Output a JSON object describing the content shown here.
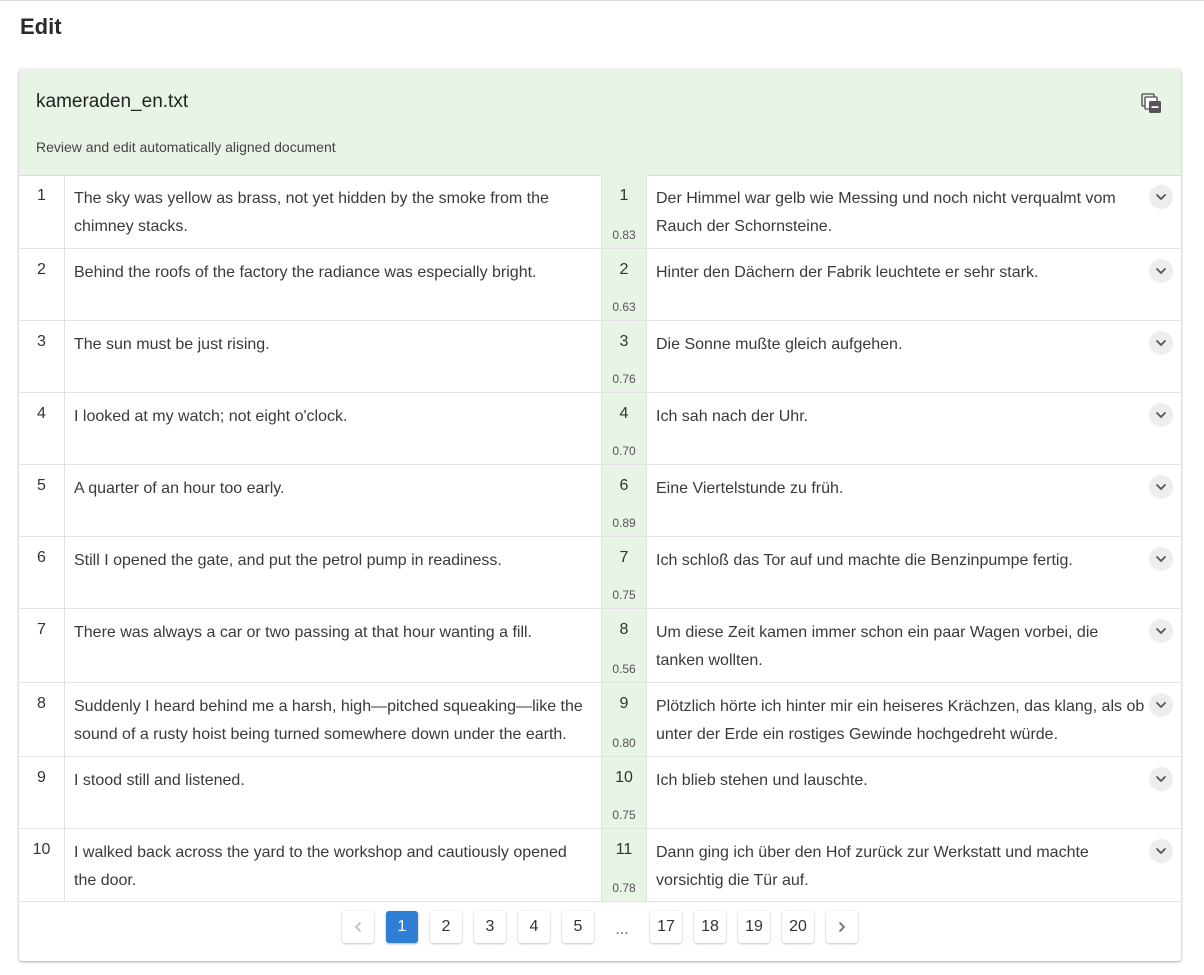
{
  "page": {
    "title": "Edit"
  },
  "document": {
    "file_name": "kameraden_en.txt",
    "subtitle": "Review and edit automatically aligned document"
  },
  "icons": {
    "copy": "copy-icon",
    "expand": "chevron-down-icon",
    "prev": "chevron-left-icon",
    "next": "chevron-right-icon"
  },
  "colors": {
    "header_bg": "#e8f4e6",
    "active_page": "#2f7fd6"
  },
  "rows": [
    {
      "num": "1",
      "source": "The sky was yellow as brass, not yet hidden by the smoke from the chimney stacks.",
      "target_num": "1",
      "score": "0.83",
      "target": "Der Himmel war gelb wie Messing und noch nicht verqualmt vom Rauch der Schornsteine."
    },
    {
      "num": "2",
      "source": "Behind the roofs of the factory the radiance was especially bright.",
      "target_num": "2",
      "score": "0.63",
      "target": "Hinter den Dächern der Fabrik leuchtete er sehr stark."
    },
    {
      "num": "3",
      "source": "The sun must be just rising.",
      "target_num": "3",
      "score": "0.76",
      "target": "Die Sonne mußte gleich aufgehen."
    },
    {
      "num": "4",
      "source": "I looked at my watch; not eight o'clock.",
      "target_num": "4",
      "score": "0.70",
      "target": "Ich sah nach der Uhr."
    },
    {
      "num": "5",
      "source": "A quarter of an hour too early.",
      "target_num": "6",
      "score": "0.89",
      "target": "Eine Viertelstunde zu früh."
    },
    {
      "num": "6",
      "source": "Still I opened the gate, and put the petrol pump in readiness.",
      "target_num": "7",
      "score": "0.75",
      "target": "Ich schloß das Tor auf und machte die Benzinpumpe fertig."
    },
    {
      "num": "7",
      "source": "There was always a car or two passing at that hour wanting a fill.",
      "target_num": "8",
      "score": "0.56",
      "target": "Um diese Zeit kamen immer schon ein paar Wagen vorbei, die tanken wollten."
    },
    {
      "num": "8",
      "source": "Suddenly I heard behind me a harsh, high—pitched squeaking—like the sound of a rusty hoist being turned somewhere down under the earth.",
      "target_num": "9",
      "score": "0.80",
      "target": "Plötzlich hörte ich hinter mir ein heiseres Krächzen, das klang, als ob unter der Erde ein rostiges Gewinde hochgedreht würde."
    },
    {
      "num": "9",
      "source": "I stood still and listened.",
      "target_num": "10",
      "score": "0.75",
      "target": "Ich blieb stehen und lauschte."
    },
    {
      "num": "10",
      "source": "I walked back across the yard to the workshop and cautiously opened the door.",
      "target_num": "11",
      "score": "0.78",
      "target": "Dann ging ich über den Hof zurück zur Werkstatt und machte vorsichtig die Tür auf."
    }
  ],
  "pagination": {
    "pages_start": [
      "1",
      "2",
      "3",
      "4",
      "5"
    ],
    "ellipsis": "...",
    "pages_end": [
      "17",
      "18",
      "19",
      "20"
    ],
    "current": "1"
  }
}
